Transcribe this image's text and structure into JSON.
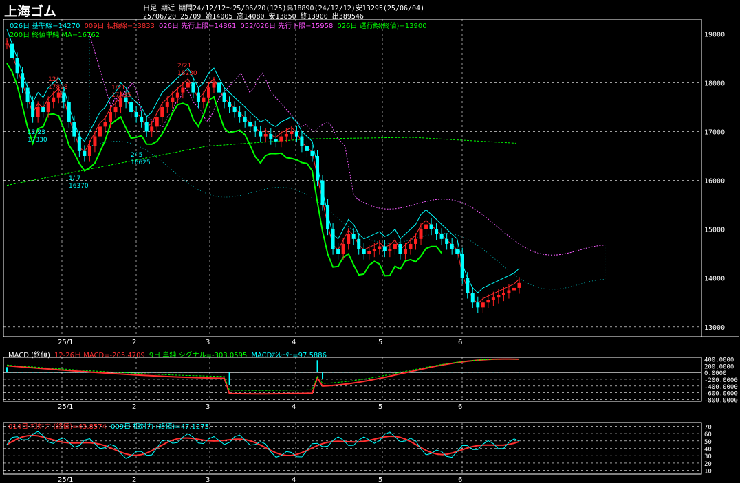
{
  "header": {
    "title": "上海ゴム",
    "line1": "日足  期近  期間24/12/12〜25/06/20(125)高18890(24/12/12)安13295(25/06/04)",
    "line2": "25/06/20 25/09 始14005 高14080 安13850 終13900 出389546"
  },
  "main_legend": [
    {
      "text": "026日 基準線=14270",
      "color": "#00ffff"
    },
    {
      "text": "009日 転換線=13833",
      "color": "#ff3030"
    },
    {
      "text": "026日 先行上限=14861",
      "color": "#ff55ff"
    },
    {
      "text": "052/026日 先行下限=15958",
      "color": "#ff55ff"
    },
    {
      "text": "026日 遅行線(終値)=13900",
      "color": "#00ff00"
    }
  ],
  "ma_legend": {
    "text": "200日 終値単純 MA=16762",
    "color": "#00ff00"
  },
  "macd_legend": [
    {
      "text": "MACD (終値)",
      "color": "#ffffff"
    },
    {
      "text": "12-26日 MACD=-205.4709",
      "color": "#ff3030"
    },
    {
      "text": "9日 単純 シグナル=-303.0595",
      "color": "#00ff00"
    },
    {
      "text": "MACDｵｼﾚｰﾀｰ=97.5886",
      "color": "#00ffff"
    }
  ],
  "rsi_legend": [
    {
      "text": "014日 相対力 (終値)=43.8574",
      "color": "#ff3030"
    },
    {
      "text": "009日 相対力 (終値)=47.1275",
      "color": "#00ffff"
    }
  ],
  "annotations": [
    {
      "label": "12/",
      "value": "17898"
    },
    {
      "label": "12/23",
      "value": "17330"
    },
    {
      "label": "1/ 7",
      "value": "16370"
    },
    {
      "label": "1/21",
      "value": "17785"
    },
    {
      "label": "2/ 5",
      "value": "16625"
    },
    {
      "label": "2/21",
      "value": "18230"
    }
  ],
  "chart_data": [
    {
      "type": "candlestick",
      "y_ticks": [
        19000,
        18000,
        17000,
        16000,
        15000,
        14000,
        13000
      ],
      "x_ticks": [
        "25/1",
        "2",
        "3",
        "4",
        "5",
        "6"
      ],
      "ylim": [
        12800,
        19300
      ],
      "closes": [
        18800,
        18500,
        18200,
        17900,
        17600,
        17300,
        17500,
        17400,
        17600,
        17700,
        17800,
        17600,
        17200,
        16900,
        16600,
        16500,
        16700,
        16900,
        17100,
        17200,
        17400,
        17500,
        17700,
        17600,
        17400,
        17300,
        17200,
        17000,
        17100,
        17300,
        17500,
        17600,
        17700,
        17800,
        17900,
        18000,
        17800,
        17600,
        17700,
        17900,
        18000,
        17800,
        17600,
        17500,
        17400,
        17300,
        17200,
        17100,
        17000,
        16900,
        16950,
        16850,
        16800,
        16900,
        16950,
        17000,
        16900,
        16700,
        16600,
        16500,
        16000,
        15500,
        15000,
        14600,
        14500,
        14700,
        14900,
        14800,
        14600,
        14500,
        14550,
        14600,
        14650,
        14550,
        14600,
        14700,
        14500,
        14600,
        14700,
        14800,
        15000,
        15100,
        15000,
        14900,
        14800,
        14700,
        14600,
        14500,
        14000,
        13700,
        13500,
        13400,
        13500,
        13550,
        13600,
        13650,
        13700,
        13750,
        13800,
        13900
      ],
      "ichimoku": {
        "base_line": 14270,
        "conversion_line": 13833,
        "leading_span_upper": 14861,
        "leading_span_lower": 15958,
        "lagging_span": 13900
      },
      "ma200": 16762
    },
    {
      "type": "line",
      "name": "MACD",
      "y_ticks": [
        400,
        200,
        0,
        -200,
        -400,
        -600,
        -800
      ],
      "y_tick_labels": [
        "400.0000",
        "200.0000",
        "0.0000",
        "-200.0000",
        "-400.0000",
        "-600.0000",
        "-800.0000"
      ],
      "ylim": [
        -850,
        450
      ],
      "x_ticks": [
        "25/1",
        "2",
        "3",
        "4",
        "5",
        "6"
      ],
      "macd": -205.4709,
      "signal": -303.0595,
      "oscillator": 97.5886
    },
    {
      "type": "line",
      "name": "RSI",
      "y_ticks": [
        70,
        60,
        50,
        40,
        30,
        20,
        10
      ],
      "ylim": [
        5,
        75
      ],
      "x_ticks": [
        "25/1",
        "2",
        "3",
        "4",
        "5",
        "6"
      ],
      "rsi14": 43.8574,
      "rsi9": 47.1275
    }
  ],
  "colors": {
    "up": "#ff2020",
    "down": "#00ffff",
    "ma": "#00ff00",
    "cloud": "#ff55ff",
    "grid": "#ffffff",
    "frame": "#ffffff"
  }
}
